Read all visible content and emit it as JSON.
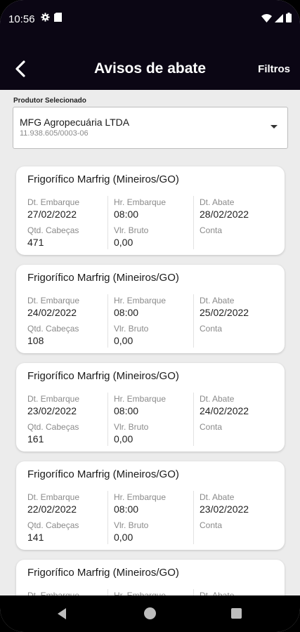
{
  "status_bar": {
    "time": "10:56",
    "left_icons": [
      "gear-icon",
      "sim-card-icon"
    ],
    "right_icons": [
      "wifi-icon",
      "signal-icon",
      "battery-icon"
    ]
  },
  "app_bar": {
    "back_icon": "chevron-left-icon",
    "title": "Avisos de abate",
    "filters_label": "Filtros"
  },
  "producer_selector": {
    "label": "Produtor Selecionado",
    "name": "MFG Agropecuária LTDA",
    "document": "11.938.605/0003-06",
    "caret_icon": "caret-down-icon"
  },
  "labels": {
    "dt_embarque": "Dt. Embarque",
    "hr_embarque": "Hr. Embarque",
    "dt_abate": "Dt. Abate",
    "qtd_cabecas": "Qtd. Cabeças",
    "vlr_bruto": "Vlr. Bruto",
    "conta": "Conta"
  },
  "notices": [
    {
      "title": "Frigorífico Marfrig (Mineiros/GO)",
      "dt_embarque": "27/02/2022",
      "hr_embarque": "08:00",
      "dt_abate": "28/02/2022",
      "qtd_cabecas": "471",
      "vlr_bruto": "0,00",
      "conta": ""
    },
    {
      "title": "Frigorífico Marfrig (Mineiros/GO)",
      "dt_embarque": "24/02/2022",
      "hr_embarque": "08:00",
      "dt_abate": "25/02/2022",
      "qtd_cabecas": "108",
      "vlr_bruto": "0,00",
      "conta": ""
    },
    {
      "title": "Frigorífico Marfrig (Mineiros/GO)",
      "dt_embarque": "23/02/2022",
      "hr_embarque": "08:00",
      "dt_abate": "24/02/2022",
      "qtd_cabecas": "161",
      "vlr_bruto": "0,00",
      "conta": ""
    },
    {
      "title": "Frigorífico Marfrig (Mineiros/GO)",
      "dt_embarque": "22/02/2022",
      "hr_embarque": "08:00",
      "dt_abate": "23/02/2022",
      "qtd_cabecas": "141",
      "vlr_bruto": "0,00",
      "conta": ""
    },
    {
      "title": "Frigorífico Marfrig (Mineiros/GO)",
      "dt_embarque": "",
      "hr_embarque": "",
      "dt_abate": "",
      "qtd_cabecas": "",
      "vlr_bruto": "",
      "conta": ""
    }
  ],
  "nav_bar": {
    "icons": [
      "nav-back-icon",
      "nav-home-icon",
      "nav-recents-icon"
    ]
  },
  "colors": {
    "header_background": "#0b0614",
    "page_background": "#ececec",
    "card_background": "#ffffff"
  }
}
